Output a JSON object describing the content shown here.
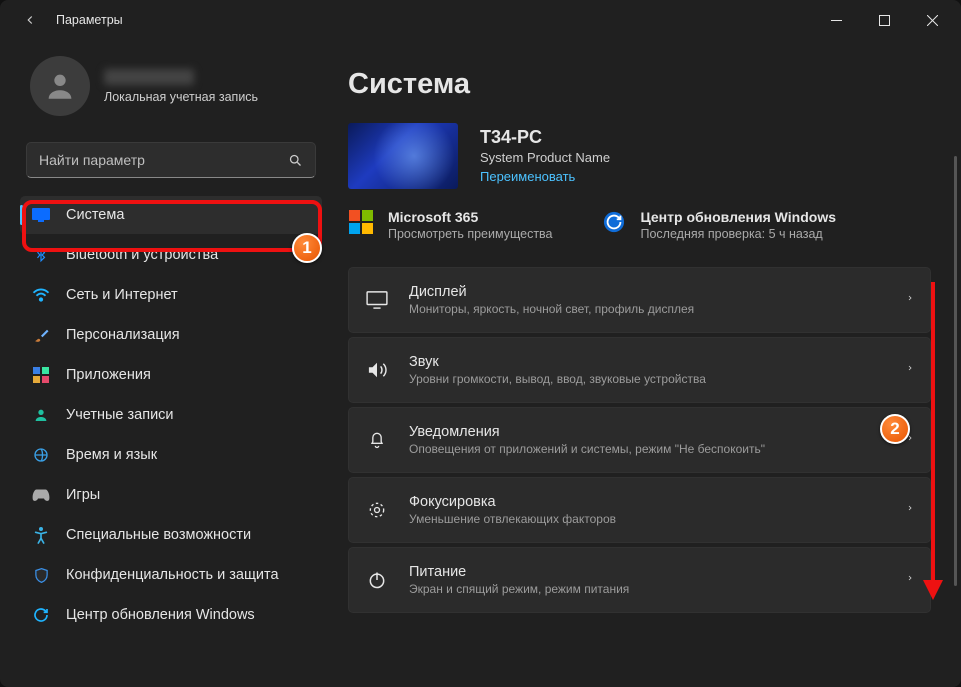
{
  "window": {
    "title": "Параметры"
  },
  "profile": {
    "account_type": "Локальная учетная запись"
  },
  "search": {
    "placeholder": "Найти параметр"
  },
  "sidebar": {
    "items": [
      {
        "label": "Система",
        "icon": "display-icon",
        "selected": true
      },
      {
        "label": "Bluetooth и устройства",
        "icon": "bluetooth-icon"
      },
      {
        "label": "Сеть и Интернет",
        "icon": "wifi-icon"
      },
      {
        "label": "Персонализация",
        "icon": "brush-icon"
      },
      {
        "label": "Приложения",
        "icon": "apps-icon"
      },
      {
        "label": "Учетные записи",
        "icon": "accounts-icon"
      },
      {
        "label": "Время и язык",
        "icon": "time-language-icon"
      },
      {
        "label": "Игры",
        "icon": "gaming-icon"
      },
      {
        "label": "Специальные возможности",
        "icon": "accessibility-icon"
      },
      {
        "label": "Конфиденциальность и защита",
        "icon": "privacy-icon"
      },
      {
        "label": "Центр обновления Windows",
        "icon": "windows-update-icon"
      }
    ]
  },
  "page": {
    "title": "Система"
  },
  "device": {
    "name": "T34-PC",
    "product": "System Product Name",
    "rename": "Переименовать"
  },
  "promo": {
    "ms365": {
      "title": "Microsoft 365",
      "sub": "Просмотреть преимущества"
    },
    "update": {
      "title": "Центр обновления Windows",
      "sub": "Последняя проверка: 5 ч назад"
    }
  },
  "cards": [
    {
      "title": "Дисплей",
      "sub": "Мониторы, яркость, ночной свет, профиль дисплея",
      "icon": "display"
    },
    {
      "title": "Звук",
      "sub": "Уровни громкости, вывод, ввод, звуковые устройства",
      "icon": "sound"
    },
    {
      "title": "Уведомления",
      "sub": "Оповещения от приложений и системы, режим \"Не беспокоить\"",
      "icon": "bell"
    },
    {
      "title": "Фокусировка",
      "sub": "Уменьшение отвлекающих факторов",
      "icon": "focus"
    },
    {
      "title": "Питание",
      "sub": "Экран и спящий режим, режим питания",
      "icon": "power"
    }
  ],
  "annotations": {
    "box1": "1",
    "num2": "2"
  }
}
